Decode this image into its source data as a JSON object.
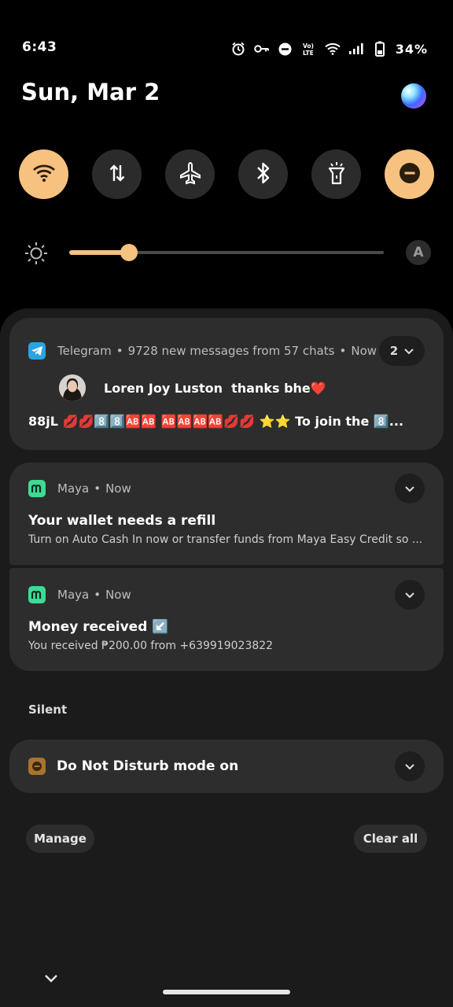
{
  "status_bar": {
    "time": "6:43",
    "battery": "34%",
    "icons": [
      "alarm-icon",
      "vpn-key-icon",
      "dnd-icon",
      "volte-icon",
      "wifi-icon",
      "signal-icon",
      "battery-icon"
    ]
  },
  "header": {
    "date": "Sun, Mar 2"
  },
  "quick_settings": [
    {
      "name": "wifi",
      "state": "on"
    },
    {
      "name": "mobile-data",
      "state": "off"
    },
    {
      "name": "airplane-mode",
      "state": "off"
    },
    {
      "name": "bluetooth",
      "state": "off"
    },
    {
      "name": "flashlight",
      "state": "off"
    },
    {
      "name": "do-not-disturb",
      "state": "on"
    }
  ],
  "brightness": {
    "level": 0.19,
    "auto_label": "A"
  },
  "notifications": [
    {
      "app": "Telegram",
      "summary": "9728 new messages from 57 chats",
      "time": "Now",
      "count": "2",
      "sender": "Loren Joy Luston",
      "message": "thanks bhe❤️",
      "preview": "88jL 💋💋8️⃣8️⃣🆎🆎 🆎🆎🆎🆎💋💋  ⭐⭐ To join the 8️⃣..."
    },
    {
      "app": "Maya",
      "time": "Now",
      "title": "Your wallet needs a refill",
      "body": "Turn on Auto Cash In now or transfer funds from Maya Easy Credit so ..."
    },
    {
      "app": "Maya",
      "time": "Now",
      "title": "Money received ↙️",
      "body": "You received ₱200.00 from +639919023822"
    }
  ],
  "silent": {
    "section_label": "Silent",
    "title": "Do Not Disturb mode  on"
  },
  "actions": {
    "manage": "Manage",
    "clear_all": "Clear all"
  },
  "colors": {
    "accent": "#f7c17f",
    "card": "#2d2d2d",
    "panel": "#1b1b1b",
    "telegram": "#2aa3e0",
    "maya": "#3ddb94",
    "dnd_icon": "#a8732d"
  }
}
